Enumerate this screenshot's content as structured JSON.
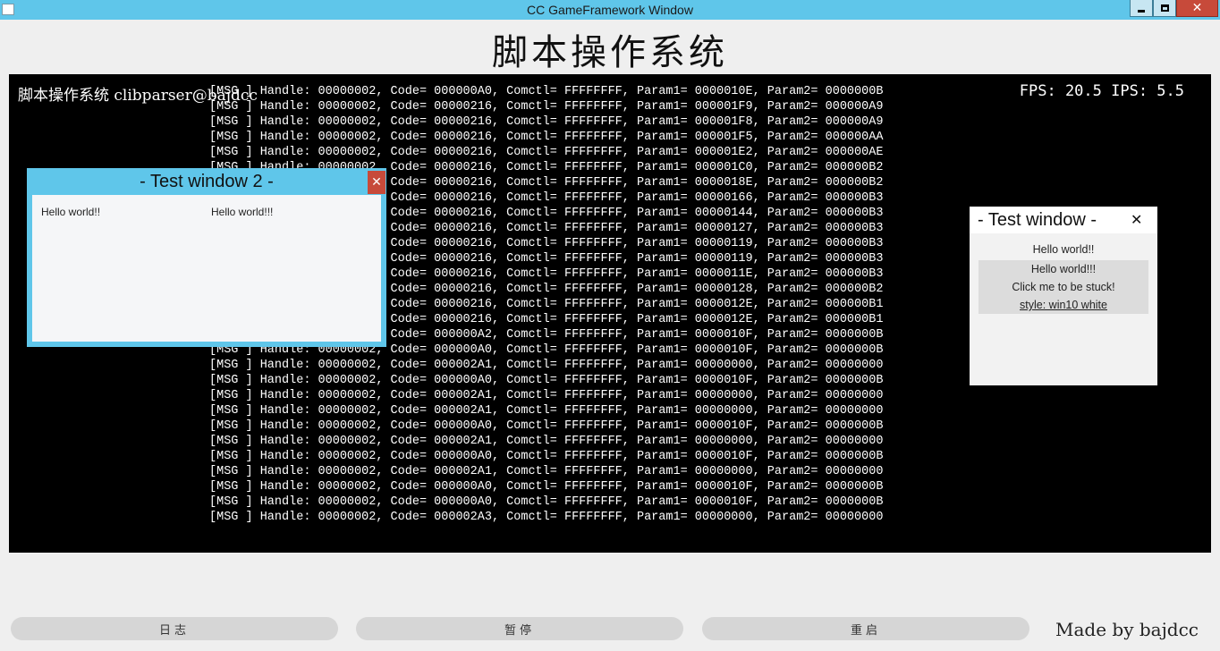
{
  "window": {
    "title": "CC GameFramework Window",
    "close_glyph": "✕"
  },
  "heading": "脚本操作系统",
  "console": {
    "header": "脚本操作系统 clibparser@bajdcc",
    "fps": "FPS: 20.5 IPS: 5.5",
    "log": [
      "[MSG ] Handle: 00000002, Code= 000000A0, Comctl= FFFFFFFF, Param1= 0000010E, Param2= 0000000B",
      "[MSG ] Handle: 00000002, Code= 00000216, Comctl= FFFFFFFF, Param1= 000001F9, Param2= 000000A9",
      "[MSG ] Handle: 00000002, Code= 00000216, Comctl= FFFFFFFF, Param1= 000001F8, Param2= 000000A9",
      "[MSG ] Handle: 00000002, Code= 00000216, Comctl= FFFFFFFF, Param1= 000001F5, Param2= 000000AA",
      "[MSG ] Handle: 00000002, Code= 00000216, Comctl= FFFFFFFF, Param1= 000001E2, Param2= 000000AE",
      "[MSG ] Handle: 00000002, Code= 00000216, Comctl= FFFFFFFF, Param1= 000001C0, Param2= 000000B2",
      "[MSG ] Handle: 00000002, Code= 00000216, Comctl= FFFFFFFF, Param1= 0000018E, Param2= 000000B2",
      "[MSG ] Handle: 00000002, Code= 00000216, Comctl= FFFFFFFF, Param1= 00000166, Param2= 000000B3",
      "[MSG ] Handle: 00000002, Code= 00000216, Comctl= FFFFFFFF, Param1= 00000144, Param2= 000000B3",
      "[MSG ] Handle: 00000002, Code= 00000216, Comctl= FFFFFFFF, Param1= 00000127, Param2= 000000B3",
      "[MSG ] Handle: 00000002, Code= 00000216, Comctl= FFFFFFFF, Param1= 00000119, Param2= 000000B3",
      "[MSG ] Handle: 00000002, Code= 00000216, Comctl= FFFFFFFF, Param1= 00000119, Param2= 000000B3",
      "[MSG ] Handle: 00000002, Code= 00000216, Comctl= FFFFFFFF, Param1= 0000011E, Param2= 000000B3",
      "[MSG ] Handle: 00000002, Code= 00000216, Comctl= FFFFFFFF, Param1= 00000128, Param2= 000000B2",
      "[MSG ] Handle: 00000002, Code= 00000216, Comctl= FFFFFFFF, Param1= 0000012E, Param2= 000000B1",
      "[MSG ] Handle: 00000002, Code= 00000216, Comctl= FFFFFFFF, Param1= 0000012E, Param2= 000000B1",
      "[MSG ] Handle: 00000002, Code= 000000A2, Comctl= FFFFFFFF, Param1= 0000010F, Param2= 0000000B",
      "[MSG ] Handle: 00000002, Code= 000000A0, Comctl= FFFFFFFF, Param1= 0000010F, Param2= 0000000B",
      "[MSG ] Handle: 00000002, Code= 000002A1, Comctl= FFFFFFFF, Param1= 00000000, Param2= 00000000",
      "[MSG ] Handle: 00000002, Code= 000000A0, Comctl= FFFFFFFF, Param1= 0000010F, Param2= 0000000B",
      "[MSG ] Handle: 00000002, Code= 000002A1, Comctl= FFFFFFFF, Param1= 00000000, Param2= 00000000",
      "[MSG ] Handle: 00000002, Code= 000002A1, Comctl= FFFFFFFF, Param1= 00000000, Param2= 00000000",
      "[MSG ] Handle: 00000002, Code= 000000A0, Comctl= FFFFFFFF, Param1= 0000010F, Param2= 0000000B",
      "[MSG ] Handle: 00000002, Code= 000002A1, Comctl= FFFFFFFF, Param1= 00000000, Param2= 00000000",
      "[MSG ] Handle: 00000002, Code= 000000A0, Comctl= FFFFFFFF, Param1= 0000010F, Param2= 0000000B",
      "[MSG ] Handle: 00000002, Code= 000002A1, Comctl= FFFFFFFF, Param1= 00000000, Param2= 00000000",
      "[MSG ] Handle: 00000002, Code= 000000A0, Comctl= FFFFFFFF, Param1= 0000010F, Param2= 0000000B",
      "[MSG ] Handle: 00000002, Code= 000000A0, Comctl= FFFFFFFF, Param1= 0000010F, Param2= 0000000B",
      "[MSG ] Handle: 00000002, Code= 000002A3, Comctl= FFFFFFFF, Param1= 00000000, Param2= 00000000"
    ]
  },
  "test_window_2": {
    "title": "- Test window 2 -",
    "close_glyph": "✕",
    "left_text": "Hello world!!",
    "right_text": "Hello world!!!"
  },
  "test_window": {
    "title": "- Test window -",
    "close_glyph": "✕",
    "items": [
      "Hello world!!",
      "Hello world!!!",
      "Click me to be stuck!",
      "style: win10 white"
    ]
  },
  "buttons": {
    "log": "日志",
    "pause": "暂停",
    "restart": "重启"
  },
  "credit": "Made by bajdcc",
  "colors": {
    "titlebar": "#5fc6ea",
    "close_red": "#c74a3a",
    "console_bg": "#000000",
    "page_bg": "#efefef"
  }
}
